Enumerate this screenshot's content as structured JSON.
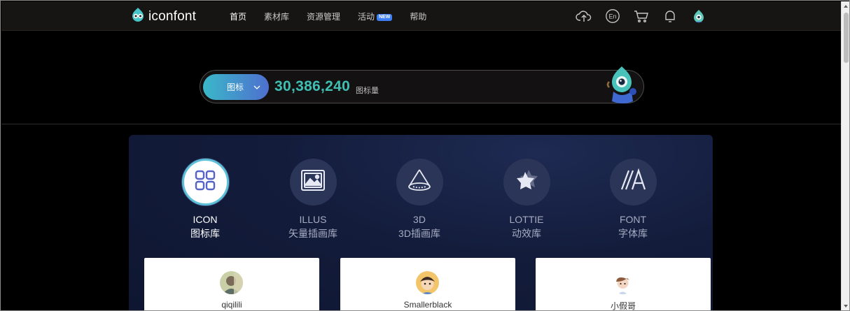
{
  "header": {
    "logo_text": "iconfont",
    "nav": [
      {
        "label": "首页",
        "active": true
      },
      {
        "label": "素材库"
      },
      {
        "label": "资源管理"
      },
      {
        "label": "活动",
        "badge": "NEW"
      },
      {
        "label": "帮助"
      }
    ],
    "icons": [
      "upload-cloud-icon",
      "language-en-icon",
      "cart-icon",
      "bell-icon",
      "user-avatar-icon"
    ],
    "lang_label": "En"
  },
  "search": {
    "selector_label": "图标",
    "count": "30,386,240",
    "count_label": "图标量"
  },
  "categories": [
    {
      "en": "ICON",
      "zh": "图标库",
      "icon": "grid-icon",
      "active": true
    },
    {
      "en": "ILLUS",
      "zh": "矢量插画库",
      "icon": "image-icon"
    },
    {
      "en": "3D",
      "zh": "3D插画库",
      "icon": "cone-3d-icon"
    },
    {
      "en": "LOTTIE",
      "zh": "动效库",
      "icon": "animation-star-icon"
    },
    {
      "en": "FONT",
      "zh": "字体库",
      "icon": "font-a-icon"
    }
  ],
  "cards": [
    {
      "name": "qiqilili"
    },
    {
      "name": "Smallerblack"
    },
    {
      "name": "小假哥"
    }
  ],
  "colors": {
    "accent": "#3fbfb2",
    "gradient_start": "#3ab8c9",
    "gradient_end": "#4e6fcf",
    "panel_bg": "#131c3b"
  }
}
